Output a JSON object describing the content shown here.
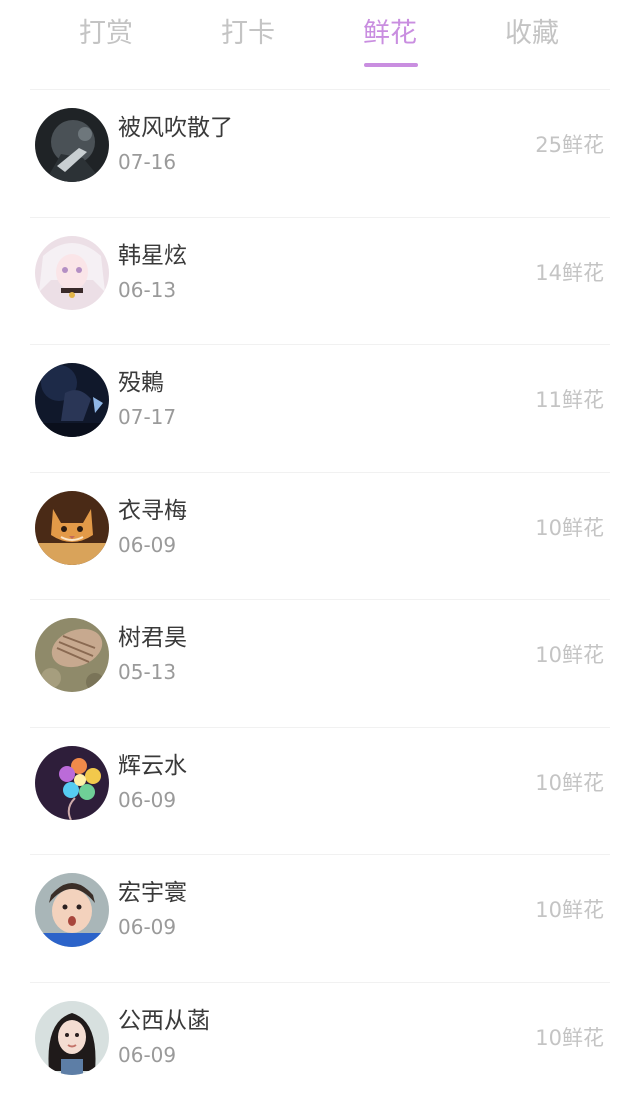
{
  "tabs": [
    {
      "label": "打赏",
      "active": false
    },
    {
      "label": "打卡",
      "active": false
    },
    {
      "label": "鲜花",
      "active": true
    },
    {
      "label": "收藏",
      "active": false
    }
  ],
  "colors": {
    "accent": "#c98ee0",
    "inactive_tab": "#c4c4c4",
    "name_text": "#3a3a3a",
    "date_text": "#9a9a9a",
    "amount_text": "#c4c4c4"
  },
  "entries": [
    {
      "name": "被风吹散了",
      "date": "07-16",
      "amount": "25鲜花",
      "avatar": "dark-photo-avatar"
    },
    {
      "name": "韩星炫",
      "date": "06-13",
      "amount": "14鲜花",
      "avatar": "anime-girl-avatar"
    },
    {
      "name": "殁鶇",
      "date": "07-17",
      "amount": "11鲜花",
      "avatar": "night-anime-avatar"
    },
    {
      "name": "衣寻梅",
      "date": "06-09",
      "amount": "10鲜花",
      "avatar": "kitten-avatar"
    },
    {
      "name": "树君昊",
      "date": "05-13",
      "amount": "10鲜花",
      "avatar": "shell-avatar"
    },
    {
      "name": "辉云水",
      "date": "06-09",
      "amount": "10鲜花",
      "avatar": "flower-balloon-avatar"
    },
    {
      "name": "宏宇寰",
      "date": "06-09",
      "amount": "10鲜花",
      "avatar": "child-face-avatar"
    },
    {
      "name": "公西从菡",
      "date": "06-09",
      "amount": "10鲜花",
      "avatar": "woman-portrait-avatar"
    }
  ]
}
